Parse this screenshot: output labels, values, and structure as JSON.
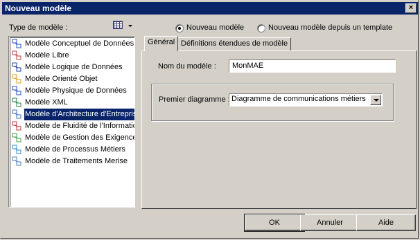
{
  "window": {
    "title": "Nouveau modèle",
    "close_glyph": "×"
  },
  "model_type_label": "Type de modèle :",
  "model_types": [
    {
      "label": "Modèle Conceptuel de Données",
      "icon": "mcd-icon",
      "color": "#2050c0"
    },
    {
      "label": "Modèle Libre",
      "icon": "free-model-icon",
      "color": "#c04040"
    },
    {
      "label": "Modèle Logique de Données",
      "icon": "mld-icon",
      "color": "#2040a0"
    },
    {
      "label": "Modèle Orienté Objet",
      "icon": "moo-icon",
      "color": "#e0a020"
    },
    {
      "label": "Modèle Physique de Données",
      "icon": "mpd-icon",
      "color": "#2050c0"
    },
    {
      "label": "Modèle XML",
      "icon": "xml-icon",
      "color": "#208040"
    },
    {
      "label": "Modèle d'Architecture d'Entreprise",
      "icon": "enterprise-icon",
      "color": "#4070c0",
      "selected": true
    },
    {
      "label": "Modèle de Fluidité de l'Information",
      "icon": "info-flow-icon",
      "color": "#c03030"
    },
    {
      "label": "Modèle de Gestion des Exigences",
      "icon": "requirements-icon",
      "color": "#40a040"
    },
    {
      "label": "Modèle de Processus Métiers",
      "icon": "business-process-icon",
      "color": "#3090d0"
    },
    {
      "label": "Modèle de Traitements Merise",
      "icon": "merise-icon",
      "color": "#5080c0"
    }
  ],
  "radio": {
    "new_model": "Nouveau modèle",
    "from_template": "Nouveau modèle depuis un template",
    "selected": "new_model"
  },
  "tabs": [
    {
      "label": "Général",
      "active": true
    },
    {
      "label": "Définitions étendues de modèle",
      "active": false
    }
  ],
  "general": {
    "model_name_label": "Nom du modèle  :",
    "model_name_value": "MonMAE",
    "first_diagram_label": "Premier diagramme :",
    "first_diagram_value": "Diagramme de communications métiers"
  },
  "buttons": {
    "ok": "OK",
    "cancel": "Annuler",
    "help": "Aide"
  }
}
